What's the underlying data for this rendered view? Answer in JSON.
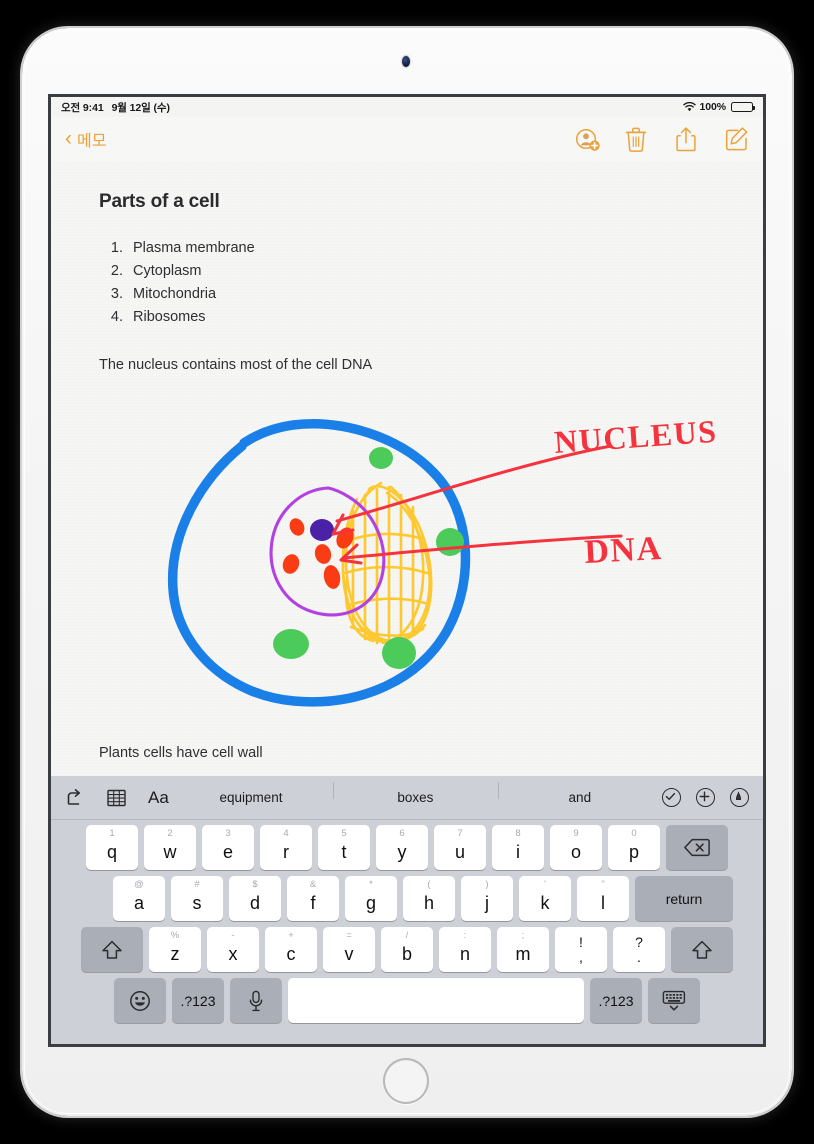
{
  "device": {
    "name": "ipad",
    "camera": "front-camera",
    "home_button": "home-button"
  },
  "status_bar": {
    "time": "오전 9:41",
    "date": "9월 12일 (수)",
    "wifi_icon": "wifi-icon",
    "battery_percent": "100%",
    "battery_icon": "battery-icon"
  },
  "nav_bar": {
    "back_label": "메모",
    "back_chevron": "chevron-left-icon",
    "actions": [
      {
        "name": "add-person-icon",
        "label": "Add People"
      },
      {
        "name": "trash-icon",
        "label": "Delete"
      },
      {
        "name": "share-icon",
        "label": "Share"
      },
      {
        "name": "compose-icon",
        "label": "New Note"
      }
    ]
  },
  "note": {
    "title": "Parts of a cell",
    "list": [
      "Plasma membrane",
      "Cytoplasm",
      "Mitochondria",
      "Ribosomes"
    ],
    "paragraph_1": "The nucleus contains most of the cell DNA",
    "paragraph_2": "Plants cells have cell wall",
    "drawing": {
      "name": "cell-diagram-sketch",
      "annotations": [
        {
          "text": "NUCLEUS",
          "color": "#f5333f"
        },
        {
          "text": "DNA",
          "color": "#f5333f"
        }
      ],
      "colors": {
        "membrane": "#1b7fe8",
        "nucleus_outline": "#b340e0",
        "nucleolus": "#4b21a8",
        "chromatin": "#fa3c14",
        "endoplasmic_reticulum": "#fdc830",
        "mitochondria": "#4ccb5a",
        "annotation": "#f5333f"
      }
    }
  },
  "keyboard": {
    "toolbar": {
      "left_icons": [
        {
          "name": "undo-icon",
          "label": "Undo"
        },
        {
          "name": "table-icon",
          "label": "Table"
        },
        {
          "name": "text-format-icon",
          "label": "Aa"
        }
      ],
      "format_label": "Aa",
      "predictions": [
        "equipment",
        "boxes",
        "and"
      ],
      "right_icons": [
        {
          "name": "checklist-icon",
          "label": "Checklist"
        },
        {
          "name": "plus-circle-icon",
          "label": "Insert"
        },
        {
          "name": "markup-pen-icon",
          "label": "Markup"
        }
      ]
    },
    "rows": [
      [
        {
          "main": "q",
          "sub": "1"
        },
        {
          "main": "w",
          "sub": "2"
        },
        {
          "main": "e",
          "sub": "3"
        },
        {
          "main": "r",
          "sub": "4"
        },
        {
          "main": "t",
          "sub": "5"
        },
        {
          "main": "y",
          "sub": "6"
        },
        {
          "main": "u",
          "sub": "7"
        },
        {
          "main": "i",
          "sub": "8"
        },
        {
          "main": "o",
          "sub": "9"
        },
        {
          "main": "p",
          "sub": "0"
        }
      ],
      [
        {
          "main": "a",
          "sub": "@"
        },
        {
          "main": "s",
          "sub": "#"
        },
        {
          "main": "d",
          "sub": "$"
        },
        {
          "main": "f",
          "sub": "&"
        },
        {
          "main": "g",
          "sub": "*"
        },
        {
          "main": "h",
          "sub": "("
        },
        {
          "main": "j",
          "sub": ")"
        },
        {
          "main": "k",
          "sub": "'"
        },
        {
          "main": "l",
          "sub": "\""
        }
      ],
      [
        {
          "main": "z",
          "sub": "%"
        },
        {
          "main": "x",
          "sub": "-"
        },
        {
          "main": "c",
          "sub": "+"
        },
        {
          "main": "v",
          "sub": "="
        },
        {
          "main": "b",
          "sub": "/"
        },
        {
          "main": "n",
          "sub": ":"
        },
        {
          "main": "m",
          "sub": ";"
        }
      ]
    ],
    "backspace": "backspace-icon",
    "return_label": "return",
    "shift_left": "shift-icon",
    "shift_right": "shift-icon",
    "punct_excl": {
      "top": "!",
      "bot": ","
    },
    "punct_ques": {
      "top": "?",
      "bot": "."
    },
    "emoji_label": "emoji-icon",
    "numeric_left_label": ".?123",
    "numeric_right_label": ".?123",
    "mic_label": "microphone-icon",
    "space_label": "",
    "hide_keyboard_label": "hide-keyboard-icon"
  }
}
